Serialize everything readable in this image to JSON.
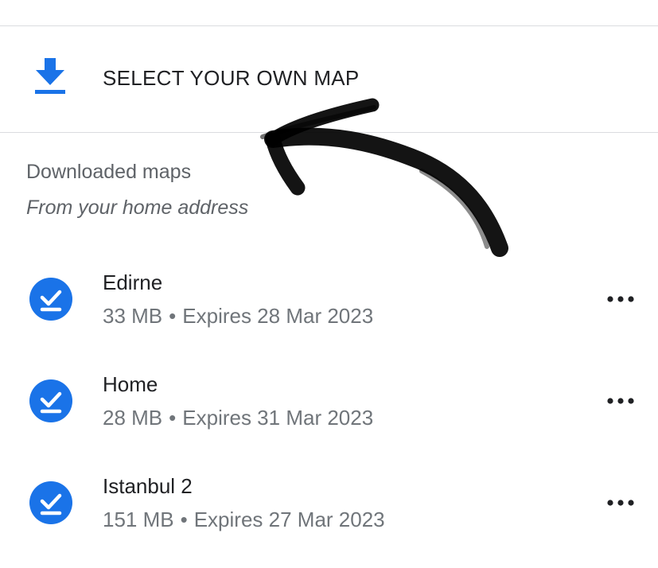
{
  "select_map": {
    "label": "SELECT YOUR OWN MAP",
    "icon": "download-icon"
  },
  "downloaded": {
    "title": "Downloaded maps",
    "subtitle": "From your home address"
  },
  "maps": [
    {
      "name": "Edirne",
      "size": "33 MB",
      "separator": "•",
      "expires": "Expires 28 Mar 2023",
      "status_icon": "check-circle-icon"
    },
    {
      "name": "Home",
      "size": "28 MB",
      "separator": "•",
      "expires": "Expires 31 Mar 2023",
      "status_icon": "check-circle-icon"
    },
    {
      "name": "Istanbul 2",
      "size": "151 MB",
      "separator": "•",
      "expires": "Expires 27 Mar 2023",
      "status_icon": "check-circle-icon"
    }
  ],
  "more_icon": "more-horizontal-icon",
  "annotation": "hand-drawn-arrow",
  "colors": {
    "accent": "#1a73e8",
    "divider": "#dadce0",
    "secondary_text": "#70757a",
    "ink": "#000000"
  }
}
